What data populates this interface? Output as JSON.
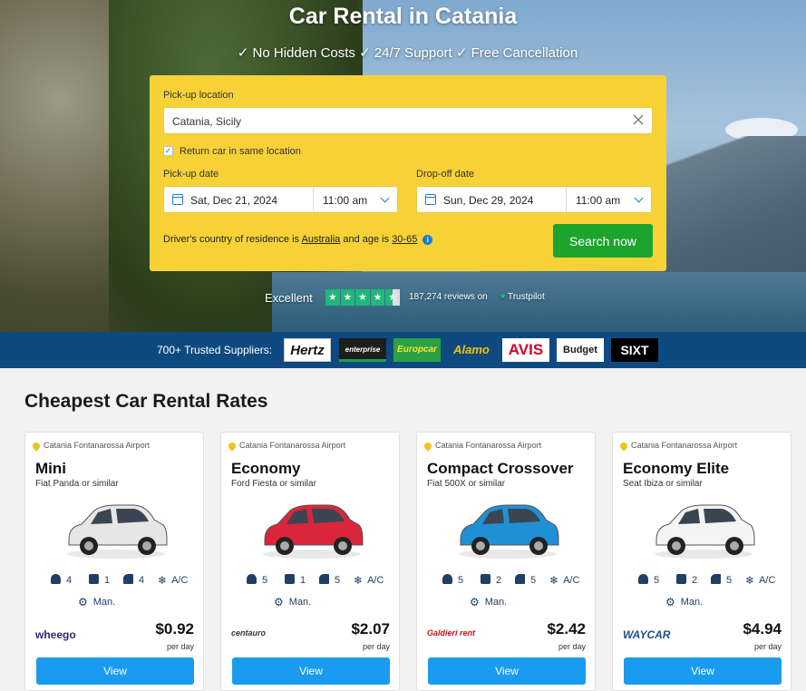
{
  "hero": {
    "title": "Car Rental in Catania",
    "subtitle": "✓ No Hidden Costs ✓ 24/7 Support ✓ Free Cancellation"
  },
  "search": {
    "pickup_location_label": "Pick-up location",
    "pickup_location_value": "Catania, Sicily",
    "return_same_label": "Return car in same location",
    "return_same_checked": true,
    "pickup_date_label": "Pick-up date",
    "pickup_date": "Sat, Dec 21, 2024",
    "pickup_time": "11:00 am",
    "dropoff_date_label": "Drop-off date",
    "dropoff_date": "Sun, Dec 29, 2024",
    "dropoff_time": "11:00 am",
    "residence_prefix": "Driver's country of residence is",
    "residence_country": "Australia",
    "age_prefix": "and age is",
    "age_range": "30-65",
    "search_button": "Search now"
  },
  "trustpilot": {
    "rating_label": "Excellent",
    "reviews": "187,274 reviews on",
    "brand": "Trustpilot"
  },
  "suppliers": {
    "label": "700+ Trusted Suppliers:",
    "logos": [
      "Hertz",
      "enterprise",
      "Europcar",
      "Alamo",
      "AVIS",
      "Budget",
      "SIXT"
    ]
  },
  "cheapest": {
    "title": "Cheapest Car Rental Rates",
    "cards": [
      {
        "location": "Catania Fontanarossa Airport",
        "class": "Mini",
        "similar": "Fiat Panda or similar",
        "passengers": "4",
        "bags_large": "1",
        "doors_icon": "",
        "doors": "4",
        "ac": "A/C",
        "transmission": "Man.",
        "vendor": "wheego",
        "price": "$0.92",
        "per": "per day",
        "button": "View",
        "color": "#e6e6e6"
      },
      {
        "location": "Catania Fontanarossa Airport",
        "class": "Economy",
        "similar": "Ford Fiesta or similar",
        "passengers": "5",
        "bags_large": "1",
        "doors": "5",
        "ac": "A/C",
        "transmission": "Man.",
        "vendor": "centauro",
        "price": "$2.07",
        "per": "per day",
        "button": "View",
        "color": "#d9263a"
      },
      {
        "location": "Catania Fontanarossa Airport",
        "class": "Compact Crossover",
        "similar": "Fiat 500X or similar",
        "passengers": "5",
        "bags_large": "2",
        "doors": "5",
        "ac": "A/C",
        "transmission": "Man.",
        "vendor": "Galdieri rent",
        "price": "$2.42",
        "per": "per day",
        "button": "View",
        "color": "#1f8fd6"
      },
      {
        "location": "Catania Fontanarossa Airport",
        "class": "Economy Elite",
        "similar": "Seat Ibiza or similar",
        "passengers": "5",
        "bags_large": "2",
        "doors": "5",
        "ac": "A/C",
        "transmission": "Man.",
        "vendor": "WAYCAR",
        "price": "$4.94",
        "per": "per day",
        "button": "View",
        "color": "#f4f4f4"
      }
    ]
  }
}
